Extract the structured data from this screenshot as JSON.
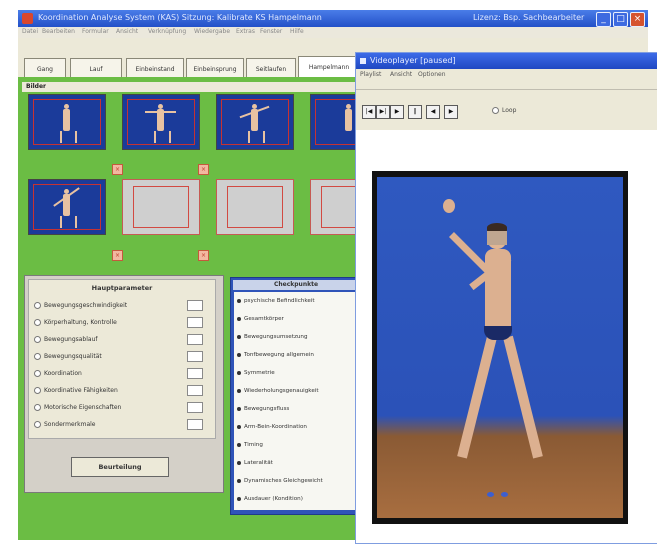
{
  "app": {
    "title": "Koordination Analyse System   (KAS)     Sitzung: Kalibrate KS     Hampelmann",
    "titlebar_user": "Lizenz:  Bsp.    Sachbearbeiter",
    "menu": [
      "Datei",
      "Bearbeiten",
      "Formular",
      "Ansicht",
      "Verknüpfung",
      "Wiedergabe",
      "Extras",
      "Fenster",
      "Hilfe"
    ],
    "window_buttons": [
      "_",
      "□",
      "×"
    ]
  },
  "tabs": [
    {
      "label": "Gang"
    },
    {
      "label": "Lauf"
    },
    {
      "label": "Einbeinstand"
    },
    {
      "label": "Einbeinsprung"
    },
    {
      "label": "Seitlaufen"
    },
    {
      "label": "Hampelmann"
    }
  ],
  "bilder": {
    "header": "Bilder",
    "delete_icon": "×"
  },
  "hauptparameter": {
    "title": "Hauptparameter",
    "items": [
      "Bewegungsgeschwindigkeit",
      "Körperhaltung, Kontrolle",
      "Bewegungsablauf",
      "Bewegungsqualität",
      "Koordination",
      "Koordinative Fähigkeiten",
      "Motorische Eigenschaften",
      "Sondermerkmale"
    ],
    "button": "Beurteilung"
  },
  "checkpunkte": {
    "title": "Checkpunkte",
    "items": [
      "psychische Befindlichkeit",
      "Gesamtkörper",
      "Bewegungsumsetzung",
      "Tonfbewegung allgemein",
      "Symmetrie",
      "Wiederholungsgenauigkeit",
      "Bewegungsfluss",
      "Arm-Bein-Koordination",
      "Timing",
      "Lateralität",
      "Dynamisches Gleichgewicht",
      "Ausdauer (Kondition)"
    ]
  },
  "videoplayer": {
    "title": "Videoplayer [paused]",
    "menu": [
      "Playlist",
      "Ansicht",
      "Optionen"
    ],
    "controls": [
      "|◀",
      "▶|",
      "▶",
      "‖",
      "◀",
      "▶"
    ],
    "loop_label": "Loop"
  },
  "colors": {
    "titlebar": "#2a58d0",
    "green_bg": "#6bbd44",
    "thumb_blue": "#1b3b9a",
    "frame_red": "#c63232",
    "check_panel": "#2f54b9"
  }
}
